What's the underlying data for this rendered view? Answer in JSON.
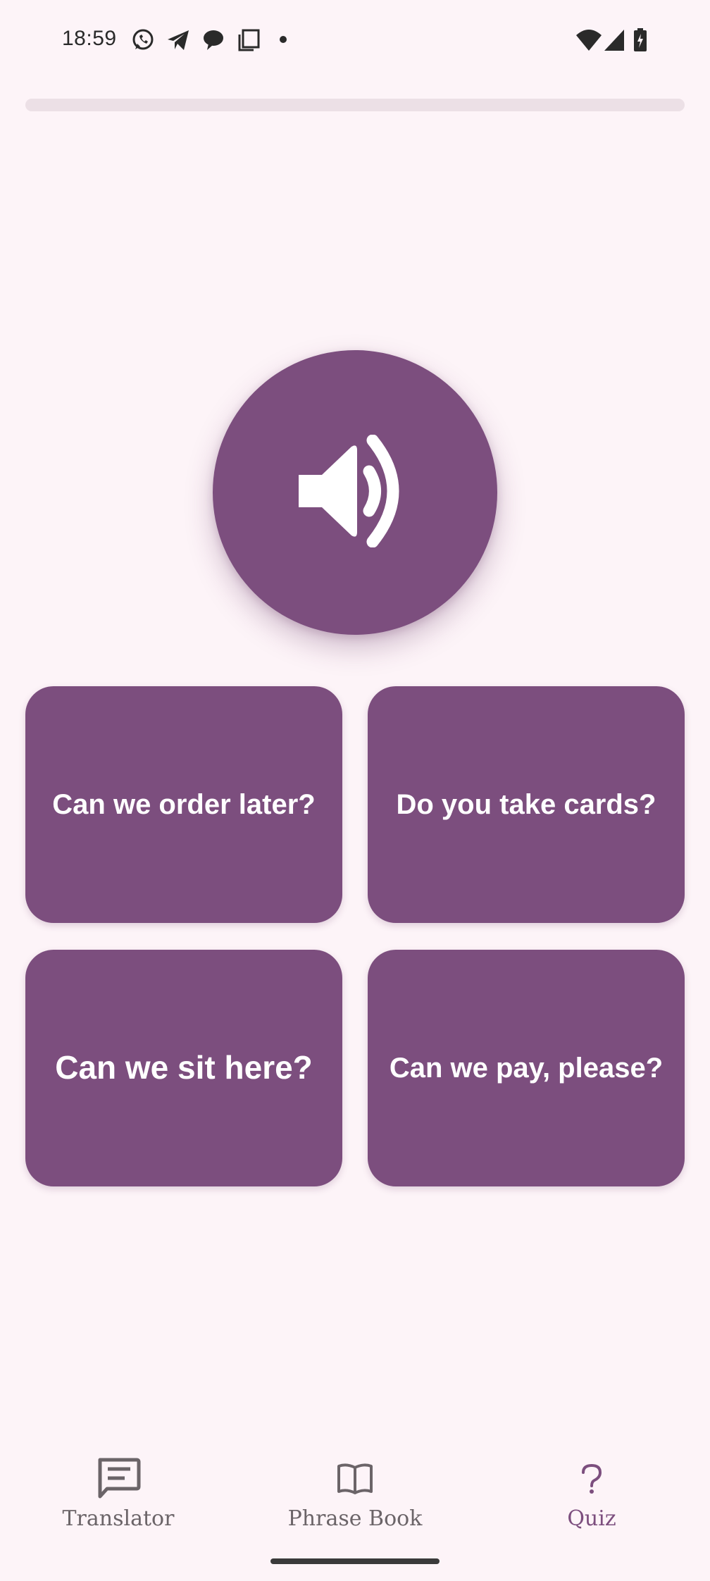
{
  "status_bar": {
    "time": "18:59",
    "left_icons": [
      "whatsapp-icon",
      "telegram-icon",
      "chat-bubble-icon",
      "copy-icon",
      "dot-icon"
    ],
    "right_icons": [
      "wifi-icon",
      "cell-signal-icon",
      "battery-charging-icon"
    ]
  },
  "quiz": {
    "progress_fraction": 0.0,
    "speaker_icon": "volume-up-icon",
    "answers": [
      {
        "label": "Can we order later?"
      },
      {
        "label": "Do you take cards?"
      },
      {
        "label": "Can we sit here?"
      },
      {
        "label": "Can we pay, please?"
      }
    ]
  },
  "bottom_nav": {
    "items": [
      {
        "label": "Translator",
        "icon": "chat-message-icon",
        "active": false
      },
      {
        "label": "Phrase Book",
        "icon": "open-book-icon",
        "active": false
      },
      {
        "label": "Quiz",
        "icon": "question-mark-icon",
        "active": true
      }
    ]
  },
  "colors": {
    "background": "#fdf4f8",
    "accent": "#7c4e7e",
    "track": "#ece0e6",
    "nav_inactive": "#6b6468"
  }
}
